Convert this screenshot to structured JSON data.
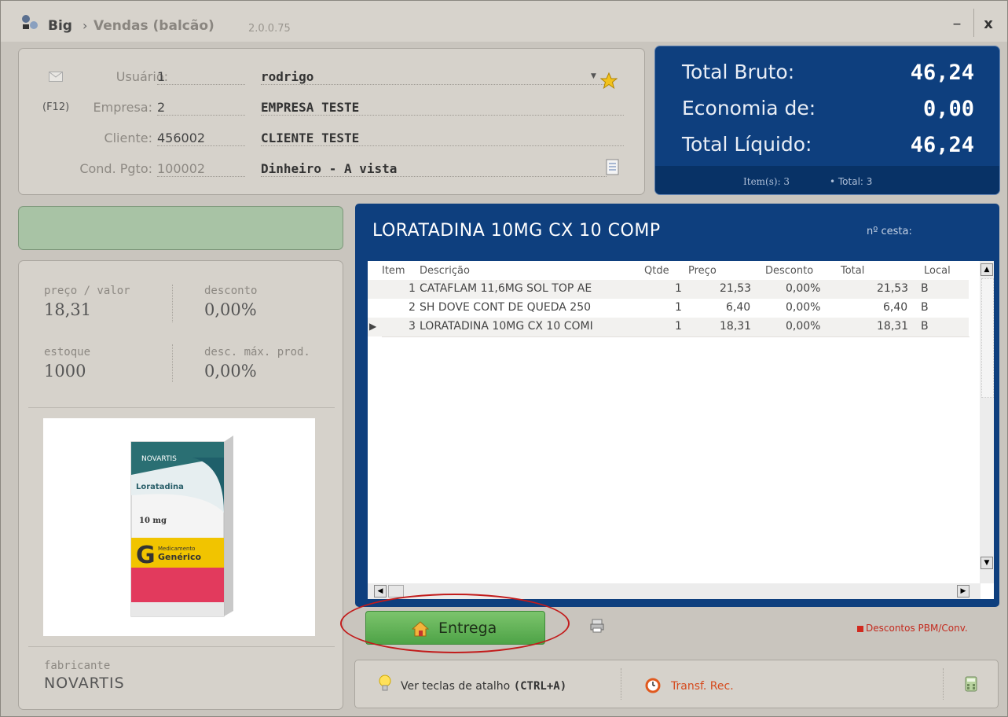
{
  "window": {
    "app": "Big",
    "separator": "›",
    "page": "Vendas (balcão)",
    "version": "2.0.0.75",
    "minimize": "–",
    "close": "x"
  },
  "header": {
    "usuario": {
      "label": "Usuário:",
      "code": "1",
      "name": "rodrigo"
    },
    "empresa": {
      "shortcut": "(F12)",
      "label": "Empresa:",
      "code": "2",
      "name": "EMPRESA TESTE"
    },
    "cliente": {
      "label": "Cliente:",
      "code": "456002",
      "name": "CLIENTE TESTE"
    },
    "cond": {
      "label": "Cond. Pgto:",
      "code": "100002",
      "name": "Dinheiro - A vista"
    }
  },
  "totals": {
    "bruto_label": "Total Bruto:",
    "bruto_value": "46,24",
    "economia_label": "Economia de:",
    "economia_value": "0,00",
    "liquido_label": "Total Líquido:",
    "liquido_value": "46,24",
    "items_text": "Item(s): 3",
    "total_text": "• Total: 3"
  },
  "product_info": {
    "preco_label": "preço / valor",
    "preco_value": "18,31",
    "desconto_label": "desconto",
    "desconto_value": "0,00%",
    "estoque_label": "estoque",
    "estoque_value": "1000",
    "descmax_label": "desc. máx. prod.",
    "descmax_value": "0,00%",
    "fabricante_label": "fabricante",
    "fabricante_value": "NOVARTIS"
  },
  "box_art": {
    "brand": "NOVARTIS",
    "name": "Loratadina",
    "dose": "10 mg",
    "letter": "G",
    "generic_1": "Medicamento",
    "generic_2": "Genérico"
  },
  "grid": {
    "title": "LORATADINA 10MG CX 10 COMP",
    "cesta_label": "nº cesta:",
    "columns": [
      "Item",
      "Descrição",
      "Qtde",
      "Preço",
      "Desconto",
      "Total",
      "Local"
    ],
    "rows": [
      {
        "item": "1",
        "desc": "CATAFLAM 11,6MG SOL TOP AE",
        "qtde": "1",
        "preco": "21,53",
        "desconto": "0,00%",
        "total": "21,53",
        "local": "B"
      },
      {
        "item": "2",
        "desc": "SH DOVE CONT DE QUEDA 250",
        "qtde": "1",
        "preco": "6,40",
        "desconto": "0,00%",
        "total": "6,40",
        "local": "B"
      },
      {
        "item": "3",
        "desc": "LORATADINA 10MG CX 10 COMI",
        "qtde": "1",
        "preco": "18,31",
        "desconto": "0,00%",
        "total": "18,31",
        "local": "B"
      }
    ],
    "selected_marker": "▶"
  },
  "actions": {
    "entrega": "Entrega",
    "descontos": "Descontos PBM/Conv.",
    "atalho_prefix": "Ver teclas de atalho ",
    "atalho_keys": "(CTRL+A)",
    "transf": "Transf. Rec."
  },
  "colors": {
    "accent_blue": "#0e3f7e",
    "entrega_green": "#5caf52",
    "alert_red": "#c21b1b"
  },
  "icons": [
    "app-icon",
    "envelope-icon",
    "star-icon",
    "document-icon",
    "home-icon",
    "printer-icon",
    "lightbulb-icon",
    "alarm-clock-icon",
    "calculator-icon"
  ]
}
